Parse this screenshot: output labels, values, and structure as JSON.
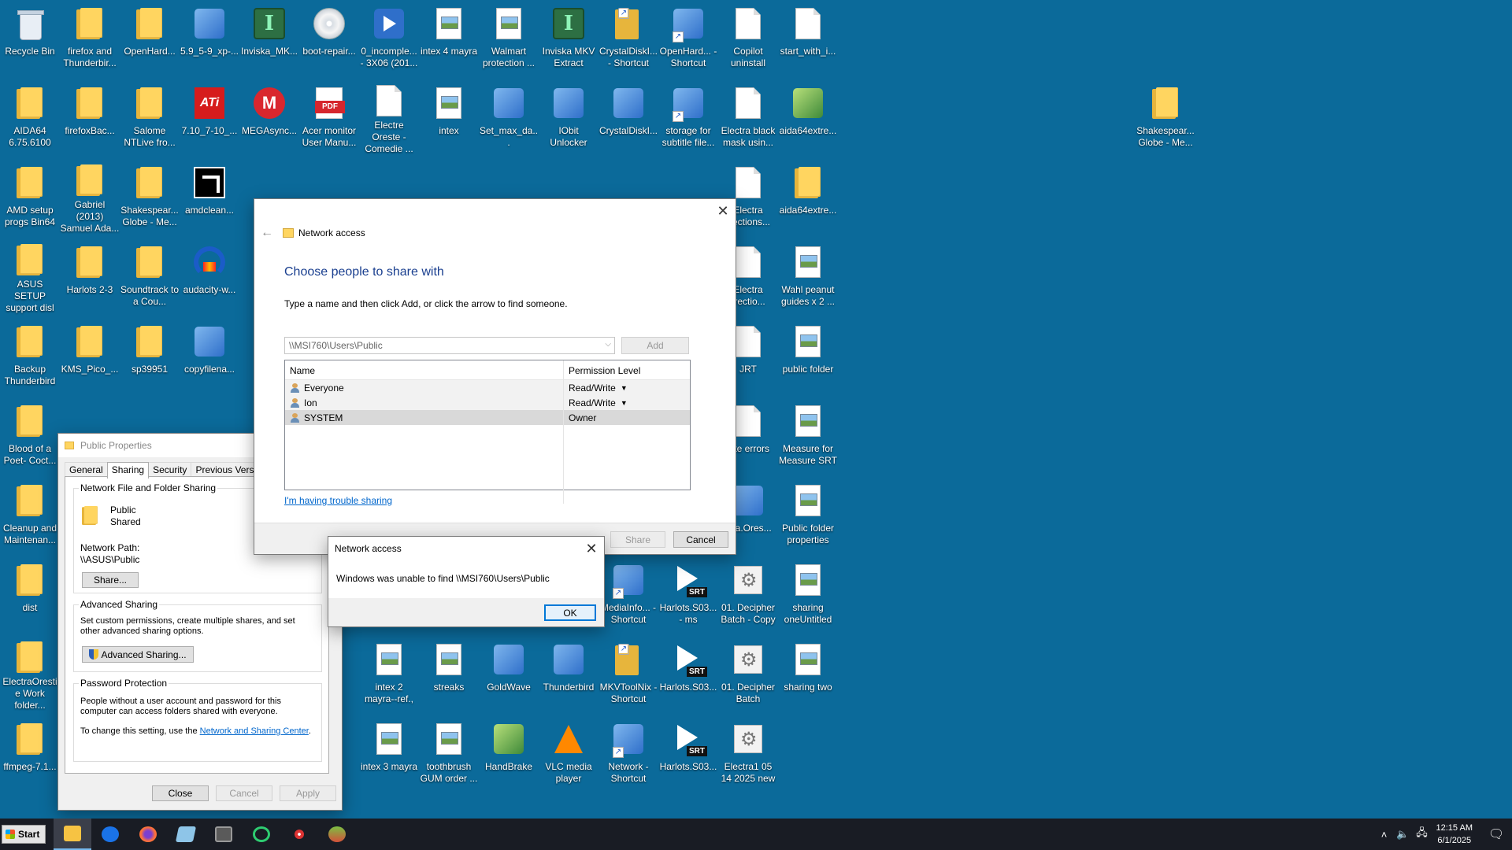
{
  "desktop": {
    "icons": [
      {
        "label": "Recycle Bin",
        "icon": "recycle-bin-icon"
      },
      {
        "label": "firefox and Thunderbir...",
        "icon": "folder-icon"
      },
      {
        "label": "OpenHard...",
        "icon": "folder-icon"
      },
      {
        "label": "5.9_5-9_xp-...",
        "icon": "app-icon"
      },
      {
        "label": "Inviska_MK...",
        "icon": "inviska-icon"
      },
      {
        "label": "boot-repair...",
        "icon": "disc-image-icon"
      },
      {
        "label": "0_incomple... - 3X06 (201...",
        "icon": "video-file-icon"
      },
      {
        "label": "intex 4 mayra",
        "icon": "image-file-icon"
      },
      {
        "label": "Walmart protection ...",
        "icon": "image-file-icon"
      },
      {
        "label": "Inviska MKV Extract",
        "icon": "inviska-icon"
      },
      {
        "label": "CrystalDiskI... - Shortcut",
        "icon": "folder-shortcut-icon"
      },
      {
        "label": "OpenHard... - Shortcut",
        "icon": "app-shortcut-icon"
      },
      {
        "label": "Copilot uninstall",
        "icon": "text-file-icon"
      },
      {
        "label": "start_with_i...",
        "icon": "text-file-icon"
      },
      {
        "label": "AIDA64 6.75.6100",
        "icon": "folder-icon"
      },
      {
        "label": "firefoxBac...",
        "icon": "folder-icon"
      },
      {
        "label": "Salome NTLive fro...",
        "icon": "folder-icon"
      },
      {
        "label": "7.10_7-10_...",
        "icon": "ati-icon"
      },
      {
        "label": "MEGAsync...",
        "icon": "mega-icon"
      },
      {
        "label": "Acer monitor User Manu...",
        "icon": "pdf-icon"
      },
      {
        "label": "Electre Oreste - Comedie ...",
        "icon": "text-file-icon"
      },
      {
        "label": "intex",
        "icon": "image-file-icon"
      },
      {
        "label": "Set_max_da...",
        "icon": "app-icon"
      },
      {
        "label": "IObit Unlocker",
        "icon": "unlocker-icon"
      },
      {
        "label": "CrystalDiskI...",
        "icon": "crystaldisk-icon"
      },
      {
        "label": "storage for subtitle file...",
        "icon": "network-shortcut-icon"
      },
      {
        "label": "Electra black mask usin...",
        "icon": "text-file-icon"
      },
      {
        "label": "aida64extre...",
        "icon": "archive-icon"
      },
      {
        "label": "Shakespear... Globe - Me...",
        "icon": "folder-icon"
      },
      {
        "label": "AMD setup progs Bin64",
        "icon": "folder-icon"
      },
      {
        "label": "Gabriel (2013) Samuel Ada...",
        "icon": "folder-icon"
      },
      {
        "label": "Shakespear... Globe - Me...",
        "icon": "folder-icon"
      },
      {
        "label": "amdclean...",
        "icon": "amd-icon"
      },
      {
        "label": "Electra rrections...",
        "icon": "text-file-icon"
      },
      {
        "label": "aida64extre...",
        "icon": "folder-icon"
      },
      {
        "label": "ASUS SETUP support disl",
        "icon": "folder-icon"
      },
      {
        "label": "Harlots 2-3",
        "icon": "folder-icon"
      },
      {
        "label": "Soundtrack to a Cou...",
        "icon": "folder-icon"
      },
      {
        "label": "audacity-w...",
        "icon": "audacity-icon"
      },
      {
        "label": "Electra rrectio...",
        "icon": "text-file-icon"
      },
      {
        "label": "Wahl peanut guides x 2 ...",
        "icon": "image-file-icon"
      },
      {
        "label": "Backup Thunderbird",
        "icon": "folder-icon"
      },
      {
        "label": "KMS_Pico_...",
        "icon": "folder-icon"
      },
      {
        "label": "sp39951",
        "icon": "folder-icon"
      },
      {
        "label": "copyfilena...",
        "icon": "installer-icon"
      },
      {
        "label": "JRT",
        "icon": "text-file-icon"
      },
      {
        "label": "public folder",
        "icon": "image-file-icon"
      },
      {
        "label": "Blood of a Poet- Coct...",
        "icon": "folder-icon"
      },
      {
        "label": "late errors",
        "icon": "text-file-icon"
      },
      {
        "label": "Measure for Measure SRT",
        "icon": "image-file-icon"
      },
      {
        "label": "Cleanup and Maintenan...",
        "icon": "folder-icon"
      },
      {
        "label": "ctra.Ores...",
        "icon": "media-file-icon"
      },
      {
        "label": "Public folder properties",
        "icon": "image-file-icon"
      },
      {
        "label": "dist",
        "icon": "folder-icon"
      },
      {
        "label": "MediaInfo... - Shortcut",
        "icon": "mediainfo-icon"
      },
      {
        "label": "Harlots.S03... - ms",
        "icon": "srt-file-icon"
      },
      {
        "label": "01. Decipher Batch - Copy",
        "icon": "batch-file-icon"
      },
      {
        "label": "sharing oneUntitled",
        "icon": "image-file-icon"
      },
      {
        "label": "ElectraOrestie Work folder...",
        "icon": "folder-icon"
      },
      {
        "label": "intex 2 mayra--ref.,",
        "icon": "image-file-icon"
      },
      {
        "label": "streaks",
        "icon": "image-file-icon"
      },
      {
        "label": "GoldWave",
        "icon": "goldwave-icon"
      },
      {
        "label": "Thunderbird",
        "icon": "thunderbird-icon"
      },
      {
        "label": "MKVToolNix - Shortcut",
        "icon": "folder-shortcut-icon"
      },
      {
        "label": "Harlots.S03...",
        "icon": "srt-file-icon"
      },
      {
        "label": "01. Decipher Batch",
        "icon": "batch-file-icon"
      },
      {
        "label": "sharing two",
        "icon": "image-file-icon"
      },
      {
        "label": "ffmpeg-7.1...",
        "icon": "folder-icon"
      },
      {
        "label": "intex 3 mayra",
        "icon": "image-file-icon"
      },
      {
        "label": "toothbrush GUM order ...",
        "icon": "image-file-icon"
      },
      {
        "label": "HandBrake",
        "icon": "handbrake-icon"
      },
      {
        "label": "VLC media player",
        "icon": "vlc-icon"
      },
      {
        "label": "Network - Shortcut",
        "icon": "network-shortcut-icon"
      },
      {
        "label": "Harlots.S03...",
        "icon": "srt-file-icon"
      },
      {
        "label": "Electra1 05 14 2025 new",
        "icon": "batch-file-icon"
      }
    ]
  },
  "properties_window": {
    "title": "Public Properties",
    "tabs": [
      "General",
      "Sharing",
      "Security",
      "Previous Versions"
    ],
    "active_tab": "Sharing",
    "network_sharing": {
      "heading": "Network File and Folder Sharing",
      "folder_name": "Public",
      "folder_state": "Shared",
      "network_path_label": "Network Path:",
      "network_path": "\\\\ASUS\\Public",
      "share_button": "Share..."
    },
    "advanced_sharing": {
      "heading": "Advanced Sharing",
      "description": "Set custom permissions, create multiple shares, and set other advanced sharing options.",
      "button": "Advanced Sharing..."
    },
    "password_protection": {
      "heading": "Password Protection",
      "description": "People without a user account and password for this computer can access folders shared with everyone.",
      "change_prefix": "To change this setting, use the ",
      "link": "Network and Sharing Center",
      "suffix": "."
    },
    "buttons": {
      "close": "Close",
      "cancel": "Cancel",
      "apply": "Apply"
    }
  },
  "wizard": {
    "title": "Network access",
    "heading": "Choose people to share with",
    "instructions": "Type a name and then click Add, or click the arrow to find someone.",
    "combo_value": "\\\\MSI760\\Users\\Public",
    "add_button": "Add",
    "columns": {
      "name": "Name",
      "permission": "Permission Level"
    },
    "rows": [
      {
        "name": "Everyone",
        "permission": "Read/Write",
        "has_dropdown": true
      },
      {
        "name": "Ion",
        "permission": "Read/Write",
        "has_dropdown": true
      },
      {
        "name": "SYSTEM",
        "permission": "Owner",
        "has_dropdown": false
      }
    ],
    "trouble_link": "I'm having trouble sharing",
    "share_button": "Share",
    "cancel_button": "Cancel"
  },
  "error_dialog": {
    "title": "Network access",
    "message": "Windows was unable to find \\\\MSI760\\Users\\Public",
    "ok_button": "OK"
  },
  "taskbar": {
    "start_label": "Start",
    "time": "12:15 AM",
    "date": "6/1/2025"
  }
}
